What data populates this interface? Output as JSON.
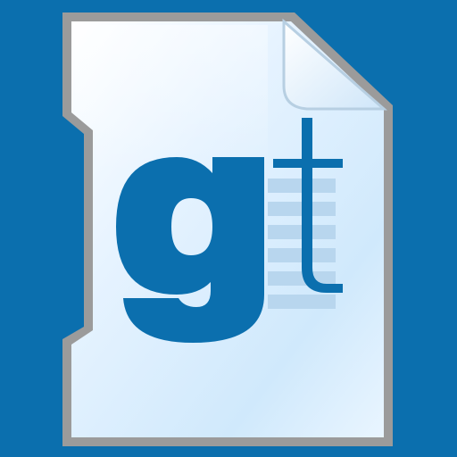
{
  "colors": {
    "background": "#0b6fae",
    "document_border": "#9b9b9b",
    "document_fill_light": "#f4faff",
    "document_fill_mid": "#dcefff",
    "document_fill_dark": "#c8e5fb",
    "fold": "#e8f4ff",
    "logo_blue": "#0b6fae",
    "text_lines": "#b8d6ee"
  },
  "icon": {
    "name": "document-icon",
    "logo_letters": "gt"
  }
}
